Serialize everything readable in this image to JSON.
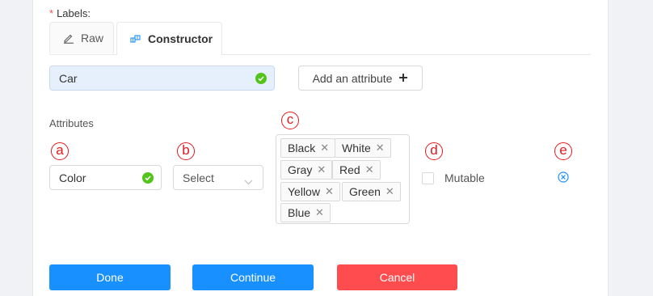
{
  "labels_section": {
    "required_mark": "*",
    "title": "Labels:",
    "tabs": [
      {
        "label": "Raw",
        "icon": "edit-icon"
      },
      {
        "label": "Constructor",
        "icon": "constructor-icon",
        "active": true
      }
    ]
  },
  "label_input": {
    "value": "Car",
    "status_icon": "check-circle-icon"
  },
  "add_attribute_button": {
    "label": "Add an attribute",
    "icon": "plus-icon"
  },
  "attributes": {
    "title": "Attributes",
    "markers": {
      "a": "ⓐ",
      "b": "ⓑ",
      "c": "ⓒ",
      "d": "ⓓ",
      "e": "ⓔ"
    },
    "row": {
      "name": "Color",
      "type_select": "Select",
      "values": [
        "Black",
        "White",
        "Gray",
        "Red",
        "Yellow",
        "Green",
        "Blue"
      ],
      "mutable_label": "Mutable",
      "mutable_checked": false
    }
  },
  "actions": {
    "done": "Done",
    "continue": "Continue",
    "cancel": "Cancel"
  },
  "colors": {
    "primary": "#1890ff",
    "danger": "#ff4d4f",
    "success": "#52c41a",
    "marker": "#e1191d"
  }
}
